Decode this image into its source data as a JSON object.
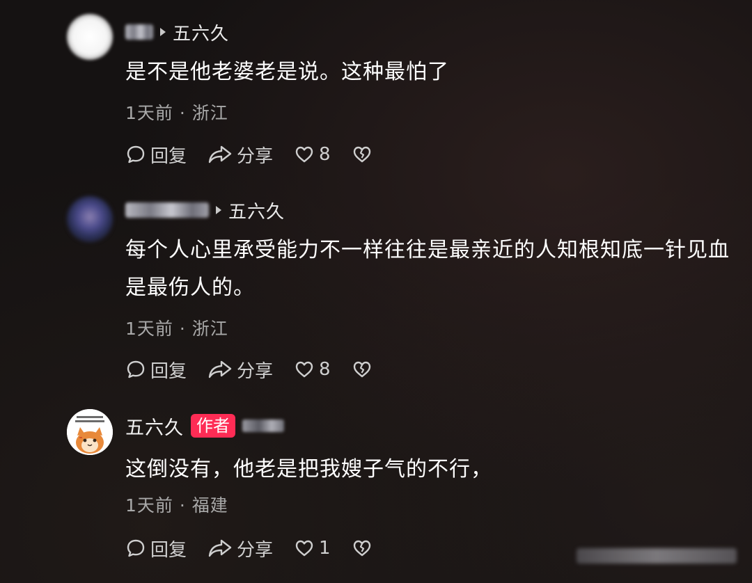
{
  "comments": [
    {
      "reply_to": "五六久",
      "text": "是不是他老婆老是说。这种最怕了",
      "time_location": "1天前 · 浙江",
      "actions": {
        "reply_label": "回复",
        "share_label": "分享",
        "like_count": "8"
      },
      "avatar": "blurred-avatar"
    },
    {
      "reply_to": "五六久",
      "text": "每个人心里承受能力不一样往往是最亲近的人知根知底一针见血是最伤人的。",
      "time_location": "1天前 · 浙江",
      "actions": {
        "reply_label": "回复",
        "share_label": "分享",
        "like_count": "8"
      },
      "avatar": "blurred-avatar"
    },
    {
      "author_name": "五六久",
      "badge": "作者",
      "text": "这倒没有，他老是把我嫂子气的不行，",
      "time_location": "1天前 · 福建",
      "actions": {
        "reply_label": "回复",
        "share_label": "分享",
        "like_count": "1"
      },
      "avatar": "cartoon-cat-avatar"
    }
  ],
  "icons": {
    "reply": "speech-bubble-icon",
    "share": "share-arrow-icon",
    "like": "heart-icon",
    "dislike": "broken-heart-icon"
  },
  "colors": {
    "background": "#151212",
    "badge": "#fe2c55",
    "secondary_text": "#a9a9a9"
  }
}
